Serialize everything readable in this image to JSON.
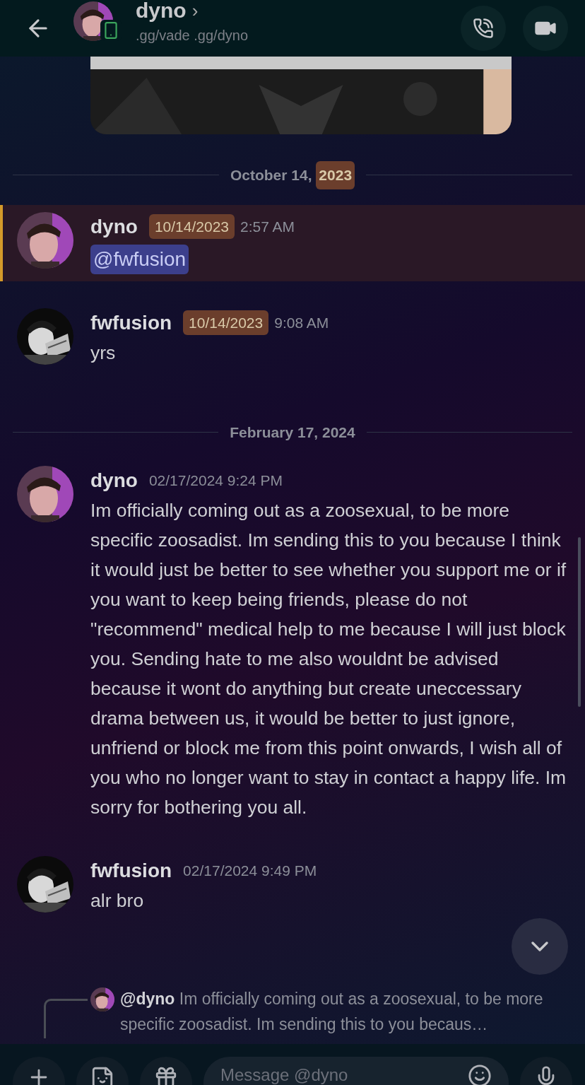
{
  "header": {
    "title": "dyno",
    "chevron": "›",
    "subtitle": ".gg/vade .gg/dyno"
  },
  "messages": [
    {
      "kind": "divider",
      "parts": [
        {
          "text": "October 14, ",
          "highlighted": false
        },
        {
          "text": "2023",
          "highlighted": true
        }
      ]
    },
    {
      "kind": "message",
      "author": "dyno",
      "mentioned": true,
      "timestamp": [
        {
          "text": "10/14/2023",
          "highlighted": true
        },
        {
          "text": "2:57 AM",
          "highlighted": false
        }
      ],
      "mention": "@fwfusion"
    },
    {
      "kind": "message",
      "author": "fwfusion",
      "mentioned": false,
      "timestamp": [
        {
          "text": "10/14/2023",
          "highlighted": true
        },
        {
          "text": "9:08 AM",
          "highlighted": false
        }
      ],
      "body": "yrs"
    },
    {
      "kind": "divider",
      "parts": [
        {
          "text": "February 17, 2024",
          "highlighted": false
        }
      ]
    },
    {
      "kind": "message",
      "author": "dyno",
      "mentioned": false,
      "timestamp": [
        {
          "text": "02/17/2024 9:24 PM",
          "highlighted": false
        }
      ],
      "body": "Im officially coming out as a zoosexual, to be more specific zoosadist. Im sending this to you because I think it would just be better to see whether you support me or if you want to keep being friends, please do not \"recommend\" medical help to me because I will just block you. Sending hate to me also wouldnt be advised because it wont do anything but create uneccessary drama between us, it would be better to just ignore, unfriend or block me from this point onwards, I wish all of you who no longer want to stay in contact a happy life. Im sorry for bothering you all."
    },
    {
      "kind": "message",
      "author": "fwfusion",
      "mentioned": false,
      "timestamp": [
        {
          "text": "02/17/2024 9:49 PM",
          "highlighted": false
        }
      ],
      "body": "alr bro"
    }
  ],
  "reply": {
    "author": "@dyno",
    "preview": "Im officially coming out as a zoosexual, to be more specific zoosadist. Im sending this to you becaus…"
  },
  "composer": {
    "placeholder": "Message @dyno"
  }
}
